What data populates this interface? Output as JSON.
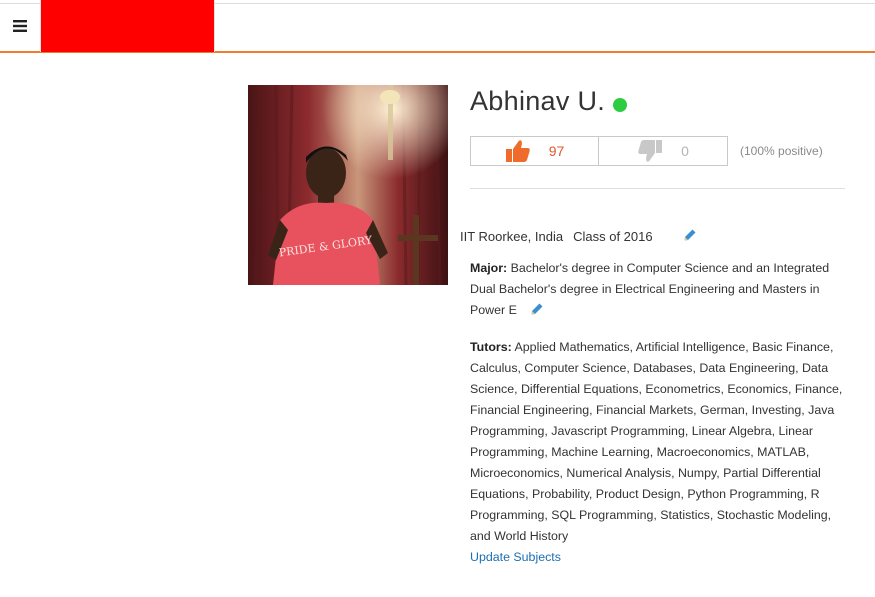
{
  "header": {
    "menu_icon": "hamburger-menu-icon",
    "brand_color": "#ff0000",
    "accent_color": "#f07c2a"
  },
  "profile": {
    "name": "Abhinav U.",
    "online_status_color": "#2ecc40",
    "photo_shirt_text": "PRIDE & GLORY",
    "rating": {
      "thumbs_up_icon": "thumbs-up-icon",
      "up_count": "97",
      "thumbs_down_icon": "thumbs-down-icon",
      "down_count": "0",
      "positive_text": "(100% positive)"
    },
    "school": "IIT Roorkee, India",
    "class_year": "Class of 2016",
    "major_label": "Major:",
    "major_text": " Bachelor's degree in Computer Science and an Integrated Dual Bachelor's degree in Electrical Engineering and Masters in Power E",
    "tutors_label": "Tutors:",
    "tutors_text": " Applied Mathematics, Artificial Intelligence, Basic Finance, Calculus, Computer Science, Databases, Data Engineering, Data Science, Differential Equations, Econometrics, Economics, Finance, Financial Engineering, Financial Markets, German, Investing, Java Programming, Javascript Programming, Linear Algebra, Linear Programming, Machine Learning, Macroeconomics, MATLAB, Microeconomics, Numerical Analysis, Numpy, Partial Differential Equations, Probability, Product Design, Python Programming, R Programming, SQL Programming, Statistics, Stochastic Modeling, and World History",
    "update_subjects_label": "Update Subjects",
    "edit_icon": "pencil-edit-icon",
    "link_color": "#1a6fb3"
  }
}
